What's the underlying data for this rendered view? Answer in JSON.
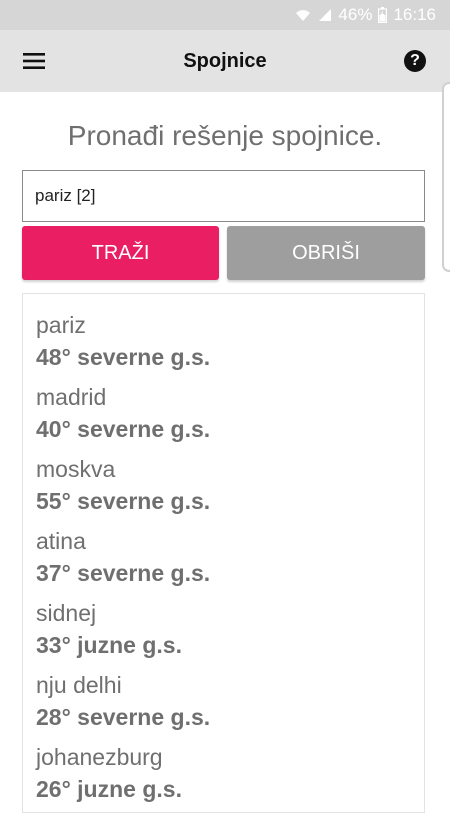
{
  "status_bar": {
    "battery": "46%",
    "time": "16:16"
  },
  "app_bar": {
    "title": "Spojnice",
    "help_glyph": "?"
  },
  "main": {
    "heading": "Pronađi rešenje spojnice.",
    "search_value": "pariz [2]",
    "search_button": "TRAŽI",
    "clear_button": "OBRIŠI"
  },
  "results": [
    {
      "city": "pariz",
      "coord": "48° severne g.s."
    },
    {
      "city": "madrid",
      "coord": "40° severne g.s."
    },
    {
      "city": "moskva",
      "coord": "55° severne g.s."
    },
    {
      "city": "atina",
      "coord": "37° severne g.s."
    },
    {
      "city": "sidnej",
      "coord": "33° juzne g.s."
    },
    {
      "city": "nju delhi",
      "coord": "28° severne g.s."
    },
    {
      "city": "johanezburg",
      "coord": "26° juzne g.s."
    }
  ],
  "colors": {
    "accent": "#e91e63",
    "secondary_button": "#9e9e9e",
    "app_bar": "#e3e3e3",
    "status_bar": "#d6d6d6"
  },
  "icons": [
    "wifi-icon",
    "signal-icon",
    "battery-icon",
    "menu-icon",
    "help-icon"
  ]
}
